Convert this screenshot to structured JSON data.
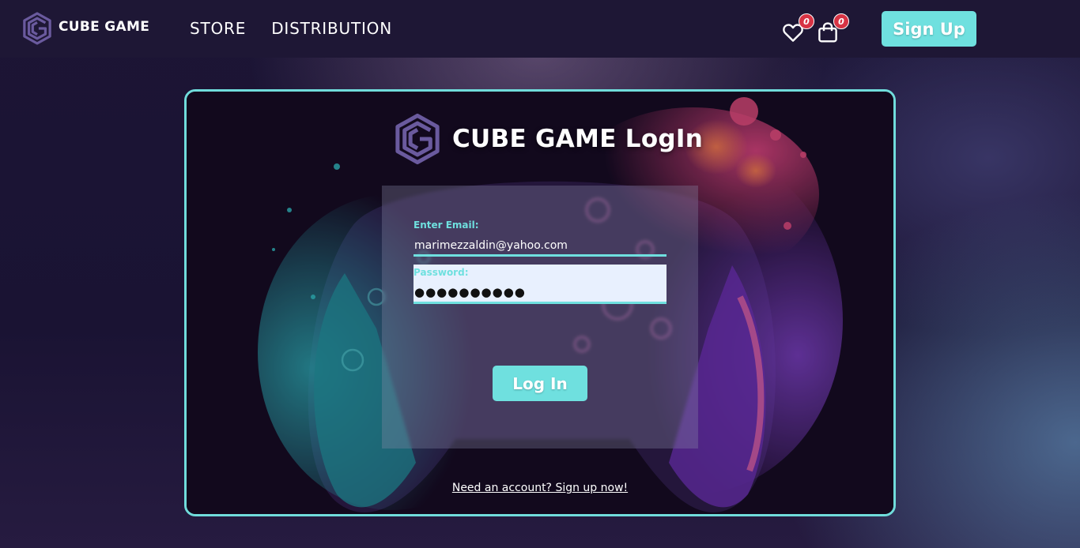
{
  "colors": {
    "accent": "#6fe0df",
    "badge": "#d73344",
    "header_bg": "#1e1735",
    "logo": "#6a5a9e"
  },
  "header": {
    "brand_name": "CUBE GAME",
    "nav": [
      {
        "label": "STORE"
      },
      {
        "label": "DISTRIBUTION"
      }
    ],
    "wishlist_count": "0",
    "cart_count": "0",
    "signup_label": "Sign Up"
  },
  "login": {
    "title": "CUBE GAME LogIn",
    "email_label": "Enter Email:",
    "email_value": "marimezzaldin@yahoo.com",
    "password_label": "Password:",
    "password_value": "●●●●●●●●●●",
    "login_label": "Log In",
    "signup_prompt": "Need an account? Sign up now!"
  },
  "icons": [
    "cube-logo-icon",
    "heart-icon",
    "shopping-bag-icon"
  ]
}
